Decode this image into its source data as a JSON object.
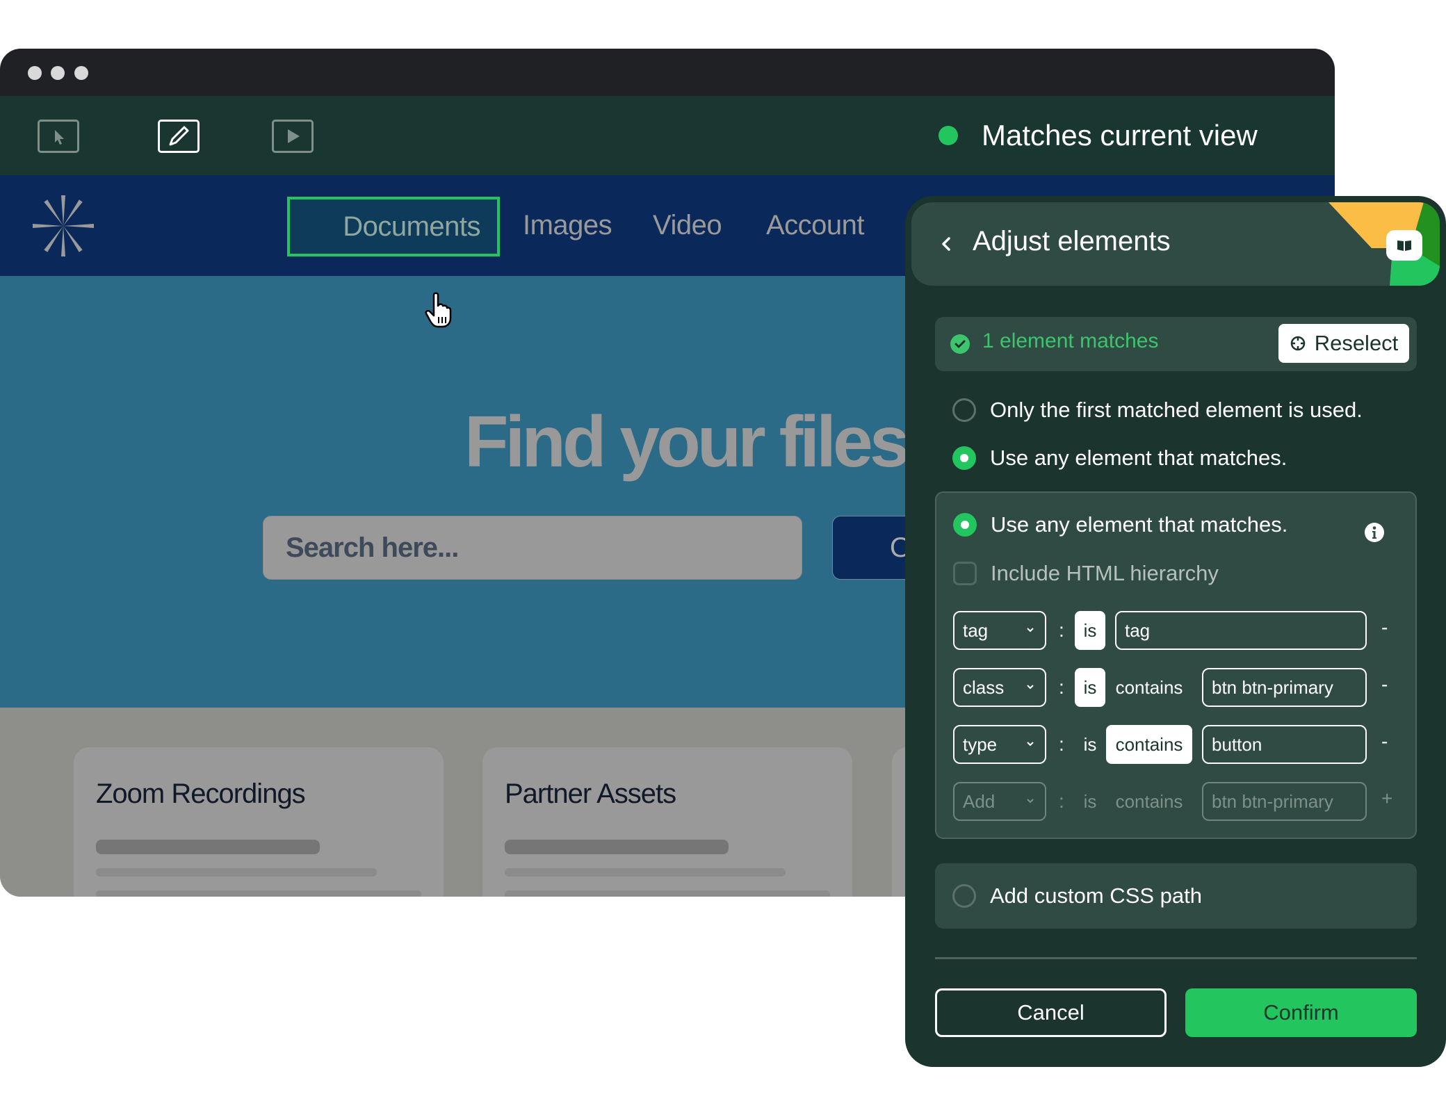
{
  "browser": {
    "window_controls": [
      "dot",
      "dot",
      "dot"
    ],
    "toolbar": {
      "tools": [
        {
          "name": "select-mode",
          "icon": "cursor-icon",
          "active": false
        },
        {
          "name": "edit-mode",
          "icon": "pencil-icon",
          "active": true
        },
        {
          "name": "preview-mode",
          "icon": "play-icon",
          "active": false
        }
      ],
      "status_text": "Matches current view",
      "status_color": "#22c55e"
    }
  },
  "site": {
    "nav": {
      "logo_icon": "asterisk-logo-icon",
      "items": [
        {
          "label": "Documents",
          "highlighted": true
        },
        {
          "label": "Images"
        },
        {
          "label": "Video"
        },
        {
          "label": "Account"
        }
      ]
    },
    "hero": {
      "title": "Find your files",
      "search_placeholder": "Search here...",
      "search_button_label": "O"
    },
    "cards": [
      {
        "title": "Zoom Recordings"
      },
      {
        "title": "Partner Assets"
      }
    ]
  },
  "panel": {
    "title": "Adjust elements",
    "back_icon": "chevron-left-icon",
    "help_icon": "book-icon",
    "match_status": "1 element matches",
    "reselect_label": "Reselect",
    "options": [
      {
        "label": "Only the first matched element is used.",
        "selected": false
      },
      {
        "label": "Use any element that matches.",
        "selected": true
      }
    ],
    "matcher": {
      "label": "Use any element that matches.",
      "selected": true,
      "include_hierarchy_label": "Include HTML hierarchy",
      "include_hierarchy_checked": false,
      "rules": [
        {
          "attribute": "tag",
          "op_is": "is",
          "op_contains": "",
          "active_op": "is",
          "value": "tag",
          "action": "-"
        },
        {
          "attribute": "class",
          "op_is": "is",
          "op_contains": "contains",
          "active_op": "is",
          "value": "btn btn-primary",
          "action": "-"
        },
        {
          "attribute": "type",
          "op_is": "is",
          "op_contains": "contains",
          "active_op": "contains",
          "value": "button",
          "action": "-"
        },
        {
          "attribute": "Add",
          "op_is": "is",
          "op_contains": "contains",
          "active_op": "",
          "value": "btn btn-primary",
          "action": "+"
        }
      ]
    },
    "custom_css_label": "Add custom CSS path",
    "custom_css_selected": false,
    "cancel_label": "Cancel",
    "confirm_label": "Confirm",
    "accent_color": "#22c55e"
  }
}
